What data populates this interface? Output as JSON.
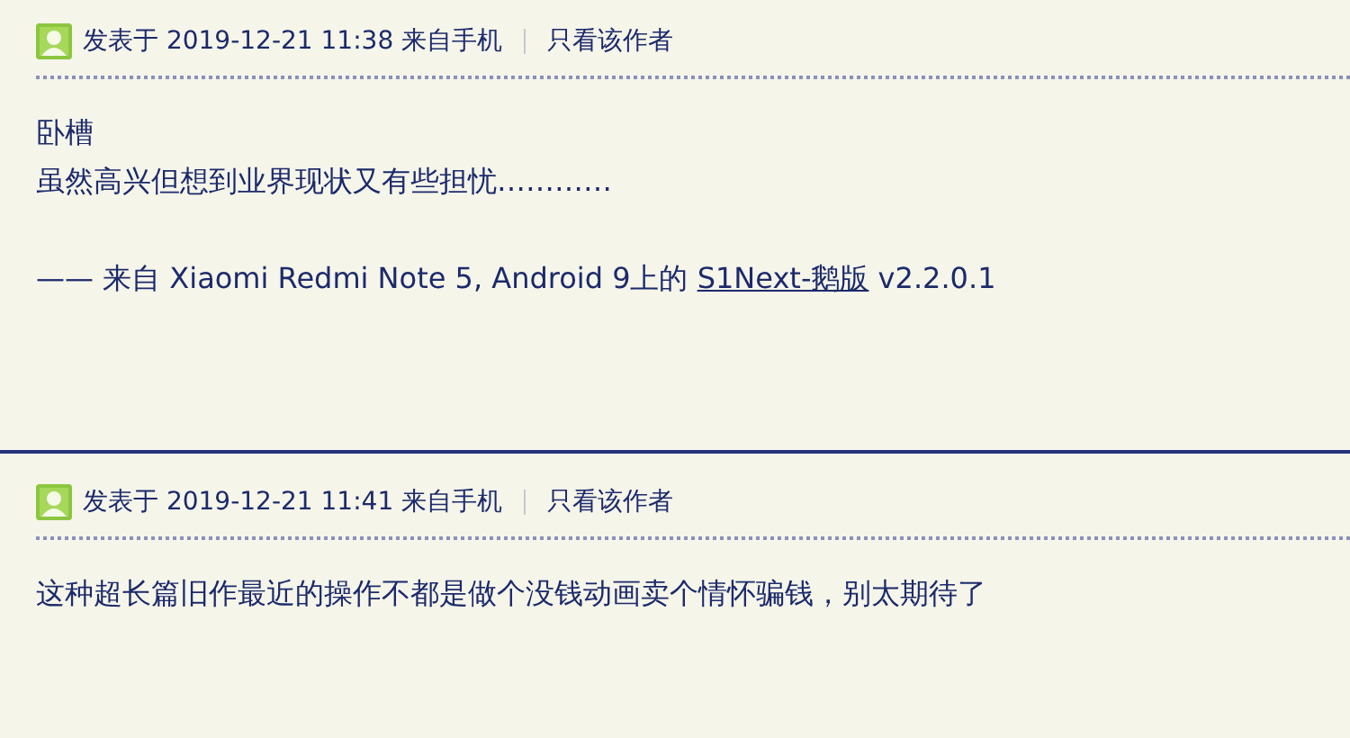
{
  "posts": [
    {
      "posted_label": "发表于 2019-12-21 11:38 来自手机",
      "author_only_link": "只看该作者",
      "lines": [
        "卧槽",
        "虽然高兴但想到业界现状又有些担忧…………"
      ],
      "signature": {
        "prefix": "—— 来自 Xiaomi Redmi Note 5, Android 9上的 ",
        "link": "S1Next-鹅版",
        "suffix": " v2.2.0.1"
      }
    },
    {
      "posted_label": "发表于 2019-12-21 11:41 来自手机",
      "author_only_link": "只看该作者",
      "lines": [
        "这种超长篇旧作最近的操作不都是做个没钱动画卖个情怀骗钱，别太期待了"
      ]
    }
  ]
}
